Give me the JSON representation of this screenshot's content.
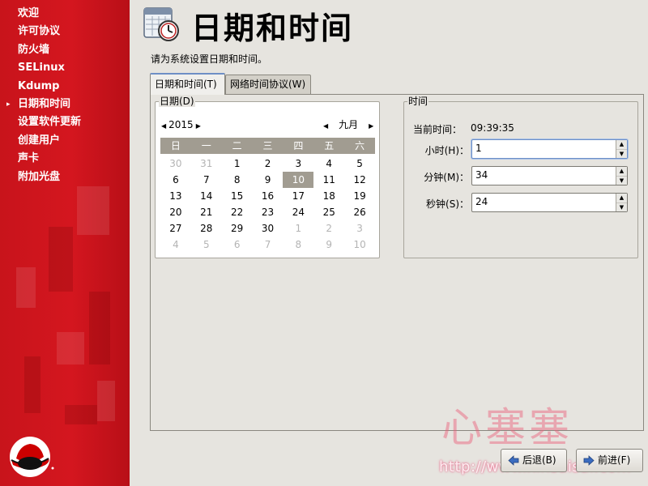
{
  "sidebar": {
    "items": [
      {
        "label": "欢迎",
        "current": false
      },
      {
        "label": "许可协议",
        "current": false
      },
      {
        "label": "防火墙",
        "current": false
      },
      {
        "label": "SELinux",
        "current": false
      },
      {
        "label": "Kdump",
        "current": false
      },
      {
        "label": "日期和时间",
        "current": true
      },
      {
        "label": "设置软件更新",
        "current": false
      },
      {
        "label": "创建用户",
        "current": false
      },
      {
        "label": "声卡",
        "current": false
      },
      {
        "label": "附加光盘",
        "current": false
      }
    ],
    "current_marker": "▸"
  },
  "header": {
    "title": "日期和时间",
    "description": "请为系统设置日期和时间。"
  },
  "tabs": [
    {
      "label": "日期和时间(T)",
      "active": true
    },
    {
      "label": "网络时间协议(W)",
      "active": false
    }
  ],
  "date": {
    "frame_label": "日期(D)",
    "year": "2015",
    "month": "九月",
    "weekdays": [
      "日",
      "一",
      "二",
      "三",
      "四",
      "五",
      "六"
    ],
    "weeks": [
      [
        {
          "d": "30",
          "dim": true
        },
        {
          "d": "31",
          "dim": true
        },
        {
          "d": "1"
        },
        {
          "d": "2"
        },
        {
          "d": "3"
        },
        {
          "d": "4"
        },
        {
          "d": "5"
        }
      ],
      [
        {
          "d": "6"
        },
        {
          "d": "7"
        },
        {
          "d": "8"
        },
        {
          "d": "9"
        },
        {
          "d": "10",
          "selected": true
        },
        {
          "d": "11"
        },
        {
          "d": "12"
        }
      ],
      [
        {
          "d": "13"
        },
        {
          "d": "14"
        },
        {
          "d": "15"
        },
        {
          "d": "16"
        },
        {
          "d": "17"
        },
        {
          "d": "18"
        },
        {
          "d": "19"
        }
      ],
      [
        {
          "d": "20"
        },
        {
          "d": "21"
        },
        {
          "d": "22"
        },
        {
          "d": "23"
        },
        {
          "d": "24"
        },
        {
          "d": "25"
        },
        {
          "d": "26"
        }
      ],
      [
        {
          "d": "27"
        },
        {
          "d": "28"
        },
        {
          "d": "29"
        },
        {
          "d": "30"
        },
        {
          "d": "1",
          "dim": true
        },
        {
          "d": "2",
          "dim": true
        },
        {
          "d": "3",
          "dim": true
        }
      ],
      [
        {
          "d": "4",
          "dim": true
        },
        {
          "d": "5",
          "dim": true
        },
        {
          "d": "6",
          "dim": true
        },
        {
          "d": "7",
          "dim": true
        },
        {
          "d": "8",
          "dim": true
        },
        {
          "d": "9",
          "dim": true
        },
        {
          "d": "10",
          "dim": true
        }
      ]
    ]
  },
  "time": {
    "frame_label": "时间",
    "current_label": "当前时间：",
    "current_value": "09:39:35",
    "hour_label": "小时(H)：",
    "hour_value": "1",
    "minute_label": "分钟(M)：",
    "minute_value": "34",
    "second_label": "秒钟(S)：",
    "second_value": "24"
  },
  "buttons": {
    "back": "后退(B)",
    "next": "前进(F)"
  },
  "watermark": {
    "text": "心塞塞",
    "url": "http://www.xinsaisai.com"
  },
  "colors": {
    "sidebar_red": "#c8141b",
    "calendar_header": "#a19c91",
    "focus_blue": "#6e8fc6"
  }
}
